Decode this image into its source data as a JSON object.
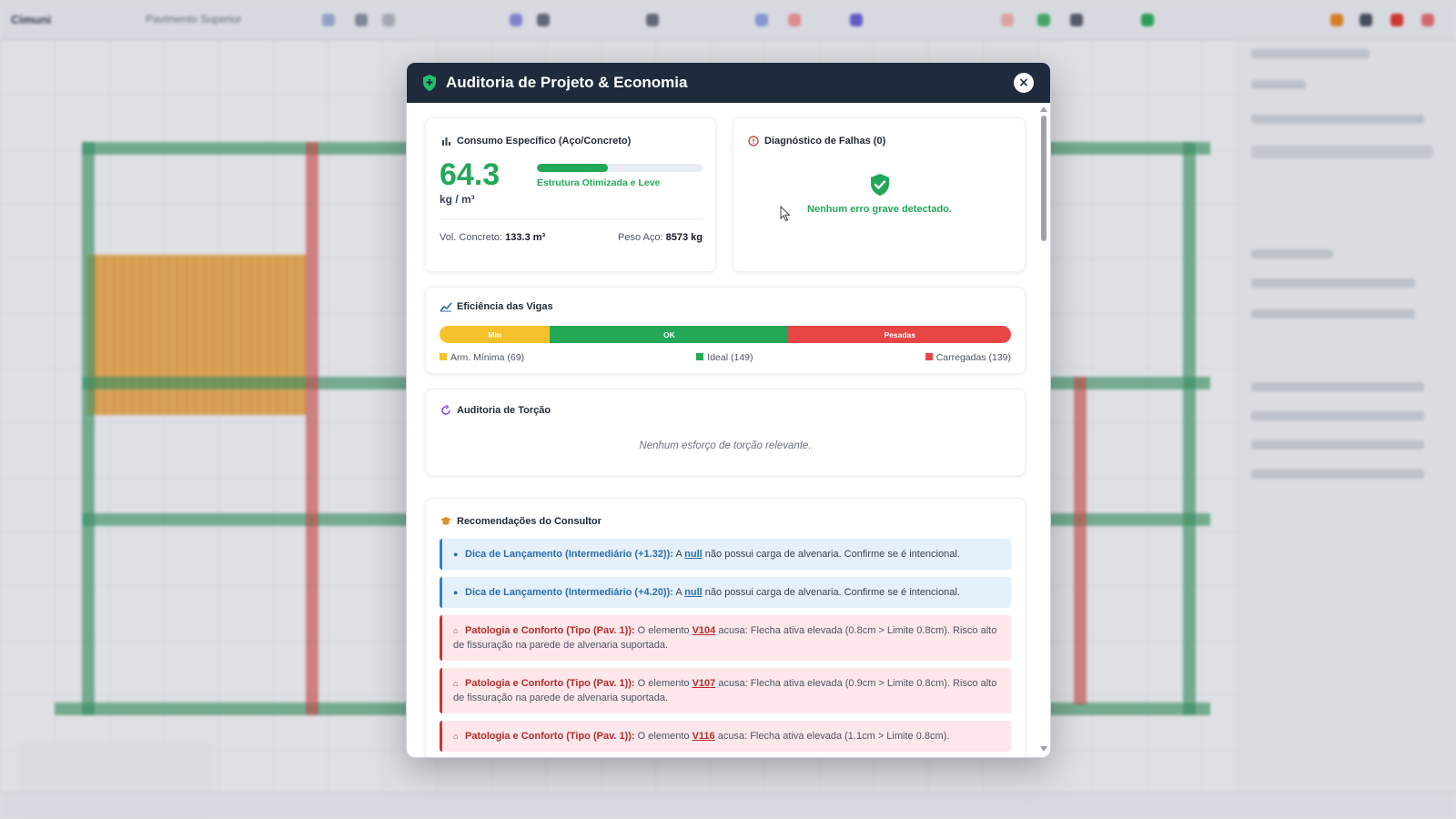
{
  "background": {
    "app_title": "Cimuni",
    "level_selector": "Pavimento Superior",
    "sidebar_header": "Propriedades"
  },
  "modal": {
    "title": "Auditoria de Projeto & Economia",
    "close_label": "×",
    "consumo": {
      "title": "Consumo Específico (Aço/Concreto)",
      "value": "64.3",
      "unit": "kg / m³",
      "progress_fraction": 0.43,
      "progress_label": "Estrutura Otimizada e Leve",
      "vol_label": "Vol. Concreto:",
      "vol_value": "133.3 m³",
      "peso_label": "Peso Aço:",
      "peso_value": "8573 kg"
    },
    "diagnostico": {
      "title": "Diagnóstico de Falhas (0)",
      "message": "Nenhum erro grave detectado."
    },
    "vigas": {
      "title": "Eficiência das Vigas",
      "segments": [
        {
          "label": "Min",
          "count": 69,
          "legend": "Arm. Mínima (69)",
          "color": "#f5c22b"
        },
        {
          "label": "OK",
          "count": 149,
          "legend": "Ideal (149)",
          "color": "#22a857"
        },
        {
          "label": "Pesadas",
          "count": 139,
          "legend": "Carregadas (139)",
          "color": "#e84545"
        }
      ]
    },
    "torcao": {
      "title": "Auditoria de Torção",
      "empty_message": "Nenhum esforço de torção relevante."
    },
    "recomendacoes": {
      "title": "Recomendações do Consultor",
      "items": [
        {
          "kind": "info",
          "title": "Dica de Lançamento (Intermediário (+1.32)):",
          "pre": " A ",
          "link": "null",
          "post": " não possui carga de alvenaria. Confirme se é intencional."
        },
        {
          "kind": "info",
          "title": "Dica de Lançamento (Intermediário (+4.20)):",
          "pre": " A ",
          "link": "null",
          "post": " não possui carga de alvenaria. Confirme se é intencional."
        },
        {
          "kind": "warn",
          "title": "Patologia e Conforto (Tipo (Pav. 1)):",
          "pre": " O elemento ",
          "link": "V104",
          "post": " acusa: Flecha ativa elevada (0.8cm > Limite 0.8cm). Risco alto de fissuração na parede de alvenaria suportada."
        },
        {
          "kind": "warn",
          "title": "Patologia e Conforto (Tipo (Pav. 1)):",
          "pre": " O elemento ",
          "link": "V107",
          "post": " acusa: Flecha ativa elevada (0.9cm > Limite 0.8cm). Risco alto de fissuração na parede de alvenaria suportada."
        },
        {
          "kind": "warn",
          "title": "Patologia e Conforto (Tipo (Pav. 1)):",
          "pre": " O elemento ",
          "link": "V116",
          "post": " acusa: Flecha ativa elevada (1.1cm > Limite 0.8cm)."
        }
      ]
    }
  }
}
